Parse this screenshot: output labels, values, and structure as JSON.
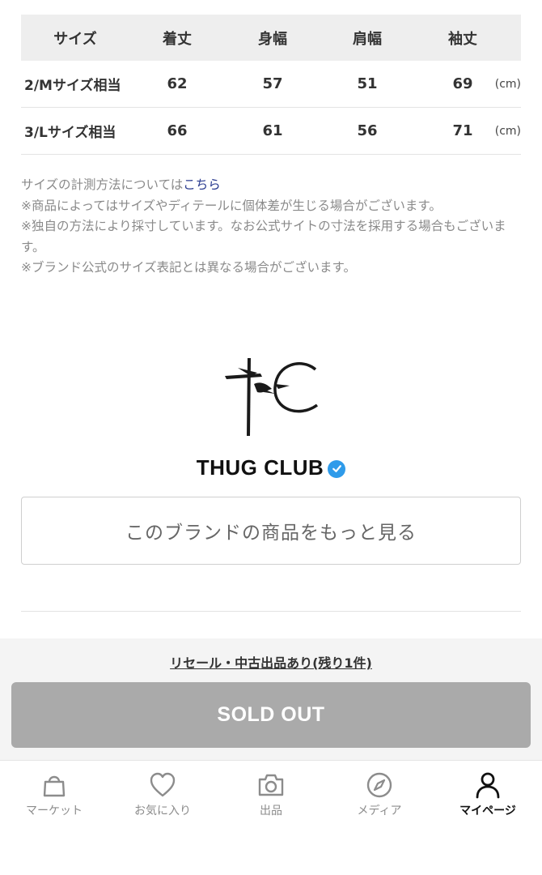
{
  "size_table": {
    "headers": [
      "サイズ",
      "着丈",
      "身幅",
      "肩幅",
      "袖丈"
    ],
    "rows": [
      {
        "size": "2/Mサイズ相当",
        "values": [
          "62",
          "57",
          "51",
          "69"
        ],
        "unit": "(cm)"
      },
      {
        "size": "3/Lサイズ相当",
        "values": [
          "66",
          "61",
          "56",
          "71"
        ],
        "unit": "(cm)"
      }
    ]
  },
  "notes": {
    "measure_prefix": "サイズの計測方法については",
    "measure_link": "こちら",
    "line1": "※商品によってはサイズやディテールに個体差が生じる場合がございます。",
    "line2": "※独自の方法により採寸しています。なお公式サイトの寸法を採用する場合もございます。",
    "line3": "※ブランド公式のサイズ表記とは異なる場合がございます。"
  },
  "brand": {
    "name": "THUG CLUB",
    "verified_icon": "check-badge-icon",
    "more_button": "このブランドの商品をもっと見る",
    "logo_color": "#1a1a1a"
  },
  "purchase": {
    "resale_link": "リセール・中古出品あり(残り1件)",
    "sold_out_label": "SOLD OUT",
    "sold_out_color": "#aaaaaa"
  },
  "tab_bar": {
    "items": [
      {
        "label": "マーケット",
        "icon": "bag-icon"
      },
      {
        "label": "お気に入り",
        "icon": "heart-icon"
      },
      {
        "label": "出品",
        "icon": "camera-icon"
      },
      {
        "label": "メディア",
        "icon": "compass-icon"
      },
      {
        "label": "マイページ",
        "icon": "person-icon",
        "active": true
      }
    ]
  }
}
